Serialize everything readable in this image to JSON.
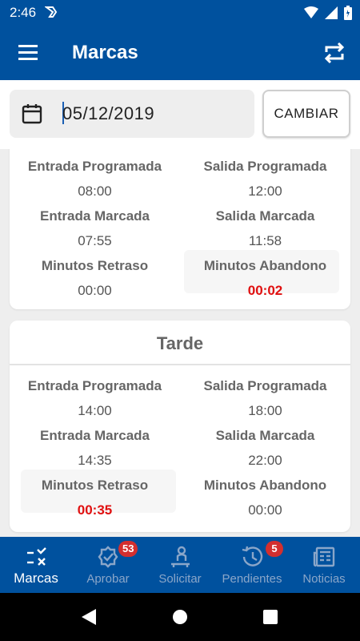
{
  "status_bar": {
    "time": "2:46"
  },
  "app_bar": {
    "title": "Marcas"
  },
  "date_filter": {
    "value": "05/12/2019",
    "button_label": "CAMBIAR"
  },
  "shifts": [
    {
      "title": "",
      "rows": [
        {
          "left_label": "Entrada Programada",
          "left_value": "08:00",
          "right_label": "Salida Programada",
          "right_value": "12:00"
        },
        {
          "left_label": "Entrada Marcada",
          "left_value": "07:55",
          "right_label": "Salida Marcada",
          "right_value": "11:58"
        },
        {
          "left_label": "Minutos Retraso",
          "left_value": "00:00",
          "right_label": "Minutos Abandono",
          "right_value": "00:02"
        }
      ]
    },
    {
      "title": "Tarde",
      "rows": [
        {
          "left_label": "Entrada Programada",
          "left_value": "14:00",
          "right_label": "Salida Programada",
          "right_value": "18:00"
        },
        {
          "left_label": "Entrada Marcada",
          "left_value": "14:35",
          "right_label": "Salida Marcada",
          "right_value": "22:00"
        },
        {
          "left_label": "Minutos Retraso",
          "left_value": "00:35",
          "right_label": "Minutos Abandono",
          "right_value": "00:00"
        }
      ]
    }
  ],
  "bottom_nav": [
    {
      "label": "Marcas",
      "icon": "punch-clock-icon",
      "active": true
    },
    {
      "label": "Aprobar",
      "icon": "verified-badge-icon",
      "badge": "53"
    },
    {
      "label": "Solicitar",
      "icon": "person-desk-icon"
    },
    {
      "label": "Pendientes",
      "icon": "history-icon",
      "badge": "5"
    },
    {
      "label": "Noticias",
      "icon": "newspaper-icon"
    }
  ],
  "colors": {
    "primary": "#00519e",
    "alert": "#e01010",
    "badge": "#d32f2f",
    "inactive_nav": "#8aa6c9"
  }
}
